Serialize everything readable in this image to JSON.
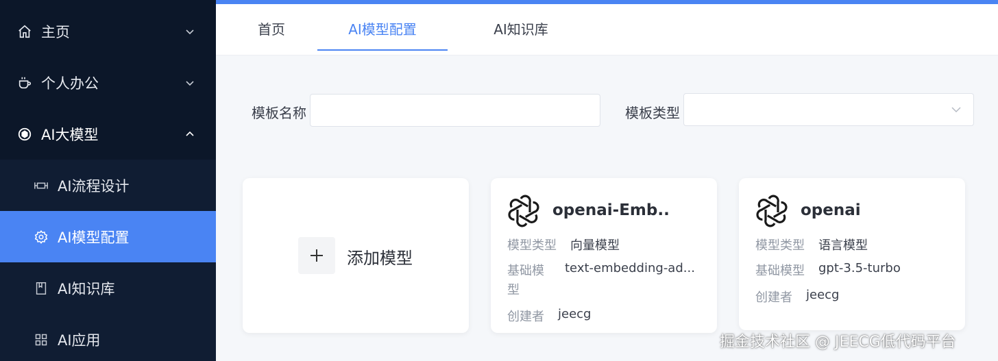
{
  "sidebar": {
    "items": [
      {
        "label": "主页",
        "icon": "home-icon"
      },
      {
        "label": "个人办公",
        "icon": "cup-icon"
      },
      {
        "label": "AI大模型",
        "icon": "ai-model-icon"
      },
      {
        "label": "AI流程设计",
        "icon": "flow-icon"
      },
      {
        "label": "AI模型配置",
        "icon": "gear-icon"
      },
      {
        "label": "AI知识库",
        "icon": "book-icon"
      },
      {
        "label": "AI应用",
        "icon": "grid-icon"
      }
    ],
    "active_color": "#4a84f3"
  },
  "tabs": [
    {
      "label": "首页"
    },
    {
      "label": "AI模型配置"
    },
    {
      "label": "AI知识库"
    }
  ],
  "filters": {
    "name_label": "模板名称",
    "name_value": "",
    "type_label": "模板类型",
    "type_value": ""
  },
  "add_card": {
    "label": "添加模型"
  },
  "cards": [
    {
      "title": "openai-Emb...",
      "type_key": "模型类型",
      "type_val": "向量模型",
      "base_key_line1": "基础模",
      "base_key_line2": "型",
      "base_val": "text-embedding-ad...",
      "creator_key": "创建者",
      "creator_val": "jeecg"
    },
    {
      "title": "openai",
      "type_key": "模型类型",
      "type_val": "语言模型",
      "base_key": "基础模型",
      "base_val": "gpt-3.5-turbo",
      "creator_key": "创建者",
      "creator_val": "jeecg"
    }
  ],
  "watermark": "掘金技术社区 @ JEECG低代码平台"
}
